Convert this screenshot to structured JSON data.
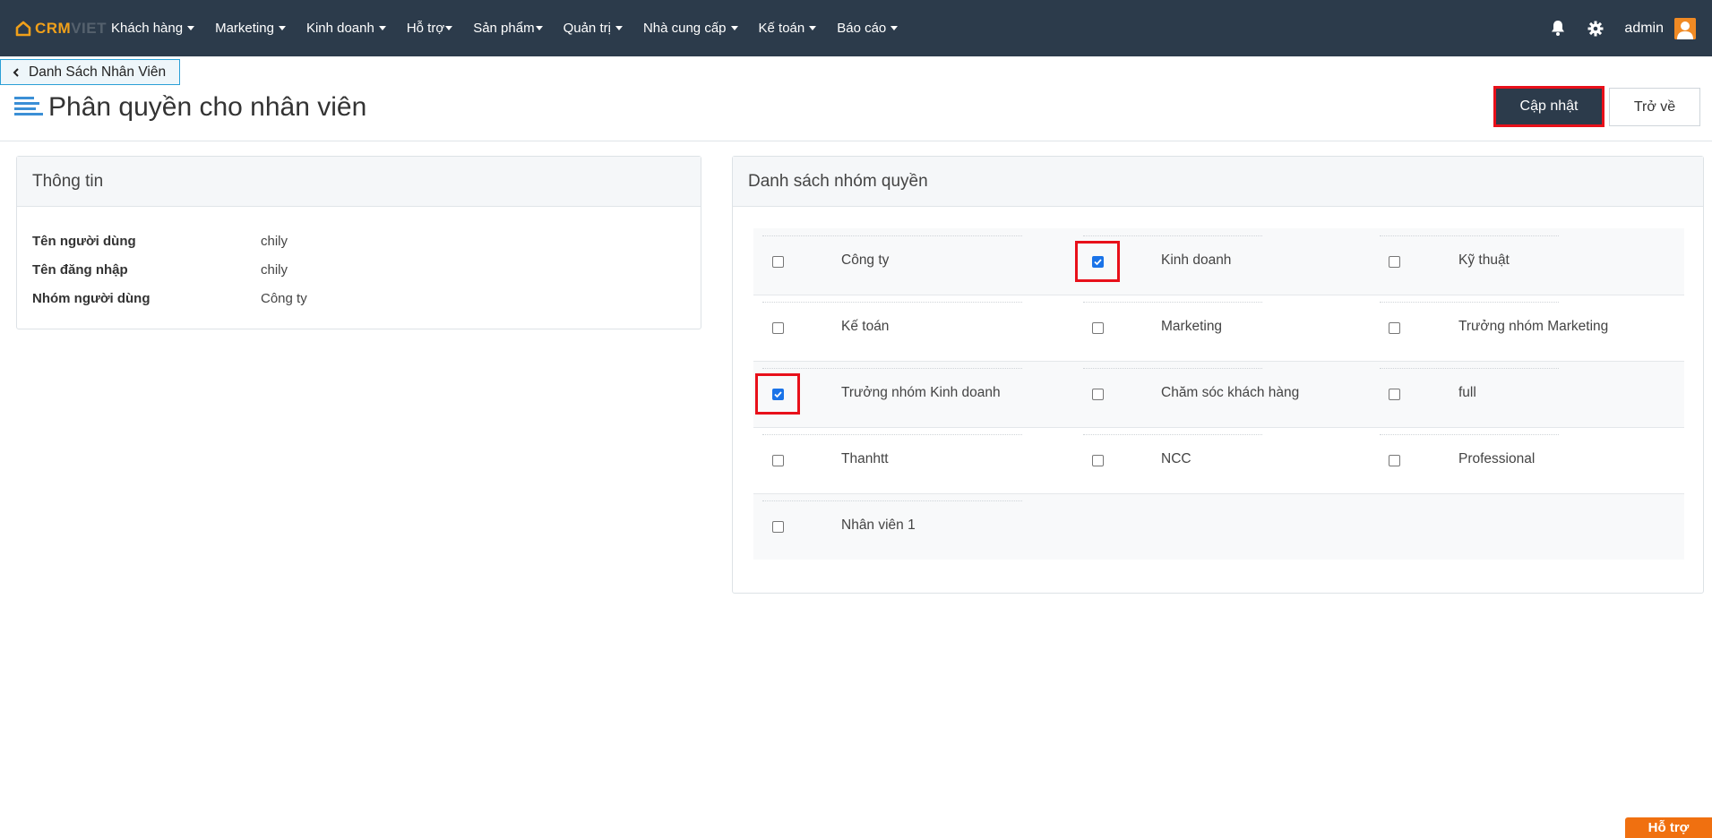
{
  "brand": {
    "part1": "CRM",
    "part2": "VIET"
  },
  "nav": {
    "items": [
      {
        "label": "Khách hàng"
      },
      {
        "label": "Marketing"
      },
      {
        "label": "Kinh doanh"
      },
      {
        "label": "Hỗ trợ"
      },
      {
        "label": "Sản phẩm"
      },
      {
        "label": "Quản trị"
      },
      {
        "label": "Nhà cung cấp"
      },
      {
        "label": "Kế toán"
      },
      {
        "label": "Báo cáo"
      }
    ],
    "user": "admin"
  },
  "breadcrumb": {
    "label": "Danh Sách Nhân Viên"
  },
  "page": {
    "title": "Phân quyền cho nhân viên",
    "update_label": "Cập nhật",
    "back_label": "Trở về"
  },
  "info": {
    "heading": "Thông tin",
    "rows": [
      {
        "label": "Tên người dùng",
        "value": "chily"
      },
      {
        "label": "Tên đăng nhập",
        "value": "chily"
      },
      {
        "label": "Nhóm người dùng",
        "value": "Công ty"
      }
    ]
  },
  "permissions": {
    "heading": "Danh sách nhóm quyền",
    "groups": [
      {
        "label": "Công ty",
        "checked": false
      },
      {
        "label": "Kinh doanh",
        "checked": true
      },
      {
        "label": "Kỹ thuật",
        "checked": false
      },
      {
        "label": "Kế toán",
        "checked": false
      },
      {
        "label": "Marketing",
        "checked": false
      },
      {
        "label": "Trưởng nhóm Marketing",
        "checked": false
      },
      {
        "label": "Trưởng nhóm Kinh doanh",
        "checked": true
      },
      {
        "label": "Chăm sóc khách hàng",
        "checked": false
      },
      {
        "label": "full",
        "checked": false
      },
      {
        "label": "Thanhtt",
        "checked": false
      },
      {
        "label": "NCC",
        "checked": false
      },
      {
        "label": "Professional",
        "checked": false
      },
      {
        "label": "Nhân viên 1",
        "checked": false
      }
    ]
  },
  "help": {
    "label": "Hỗ trợ"
  },
  "colors": {
    "nav_bg": "#2c3b4b",
    "accent": "#f0a01a",
    "highlight": "#e8101a",
    "help": "#f07010"
  }
}
